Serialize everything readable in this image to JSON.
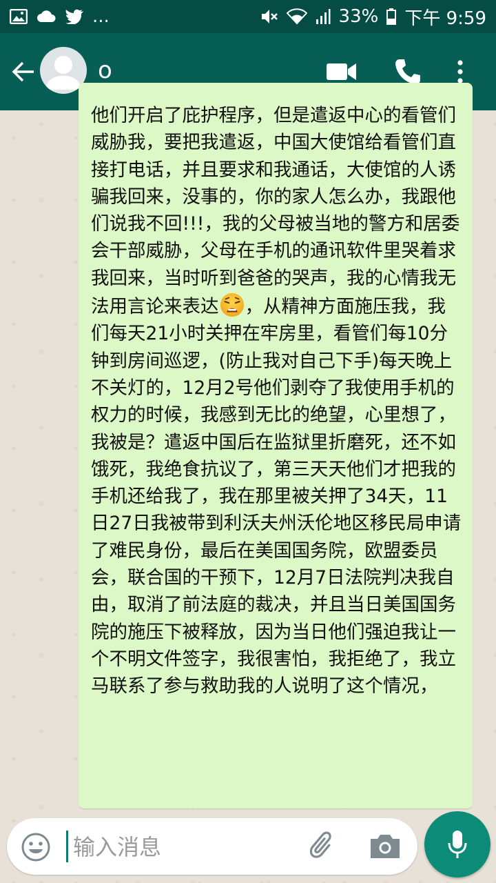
{
  "status_bar": {
    "battery": "33%",
    "time": "下午 9:59",
    "more": "..."
  },
  "header": {
    "contact_name": "o"
  },
  "message": {
    "text_before_emoji": "他们开启了庇护程序，但是遣返中心的看管们威胁我，要把我遣返，中国大使馆给看管们直接打电话，并且要求和我通话，大使馆的人诱骗我回来，没事的，你的家人怎么办，我跟他们说我不回!!!，我的父母被当地的警方和居委会干部威胁，父母在手机的通讯软件里哭着求我回来，当时听到爸爸的哭声，我的心情我无法用言论来表达",
    "emoji": "weary-face",
    "text_after_emoji": "，从精神方面施压我，我们每天21小时关押在牢房里，看管们每10分钟到房间巡逻，(防止我对自己下手)每天晚上不关灯的，12月2号他们剥夺了我使用手机的权力的时候，我感到无比的绝望，心里想了，我被是？遣返中国后在监狱里折磨死，还不如饿死，我绝食抗议了，第三天天他们才把我的手机还给我了，我在那里被关押了34天，11日27日我被带到利沃夫州沃伦地区移民局申请了难民身份，最后在美国国务院，欧盟委员会，联合国的干预下，12月7日法院判决我自由，取消了前法庭的裁决，并且当日美国国务院的施压下被释放，因为当日他们强迫我让一个不明文件签字，我很害怕，我拒绝了，我立马联系了参与救助我的人说明了这个情况，"
  },
  "composer": {
    "placeholder": "输入消息"
  },
  "colors": {
    "header": "#075e54",
    "status_bar": "#054d44",
    "outgoing_bubble": "#dcf8c6",
    "accent": "#0c8b78"
  }
}
